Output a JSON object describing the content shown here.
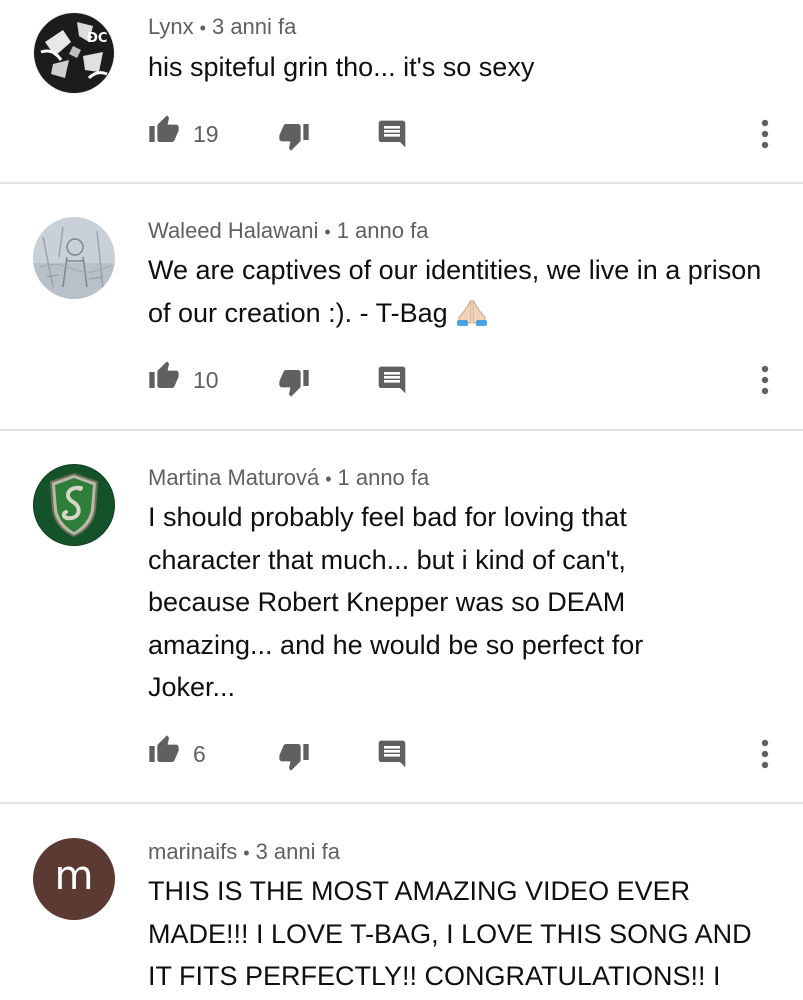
{
  "comments": [
    {
      "author": "Lynx",
      "time": "3 anni fa",
      "text": "his spiteful grin tho... it's so sexy",
      "likes": "19",
      "avatar": "dark-pattern-avatar"
    },
    {
      "author": "Waleed Halawani",
      "time": "1 anno fa",
      "text": "We are captives of our identities, we live in a prison of our creation :). - T-Bag",
      "emoji": "folded-hands",
      "likes": "10",
      "avatar": "sketch-avatar"
    },
    {
      "author": "Martina Maturová",
      "time": "1 anno fa",
      "text": "I should probably feel bad for loving that character that much... but i kind of can't, because Robert Knepper was so DEAM amazing... and he would be so perfect for Joker...",
      "likes": "6",
      "avatar": "slytherin-crest-avatar"
    },
    {
      "author": "marinaifs",
      "time": "3 anni fa",
      "text": "THIS IS THE MOST AMAZING VIDEO EVER MADE!!! I LOVE T-BAG, I LOVE THIS SONG AND IT FITS PERFECTLY!! CONGRATULATIONS!! I",
      "avatar_letter": "m",
      "avatar": "letter-avatar"
    }
  ],
  "separator": "•",
  "colors": {
    "text": "#0f0f0f",
    "meta": "#606060",
    "icon": "#606060",
    "divider": "#e3e3e3",
    "letter_avatar_bg": "#5b3a34"
  },
  "icons": [
    "thumbs-up-icon",
    "thumbs-down-icon",
    "reply-icon",
    "more-vert-icon"
  ]
}
